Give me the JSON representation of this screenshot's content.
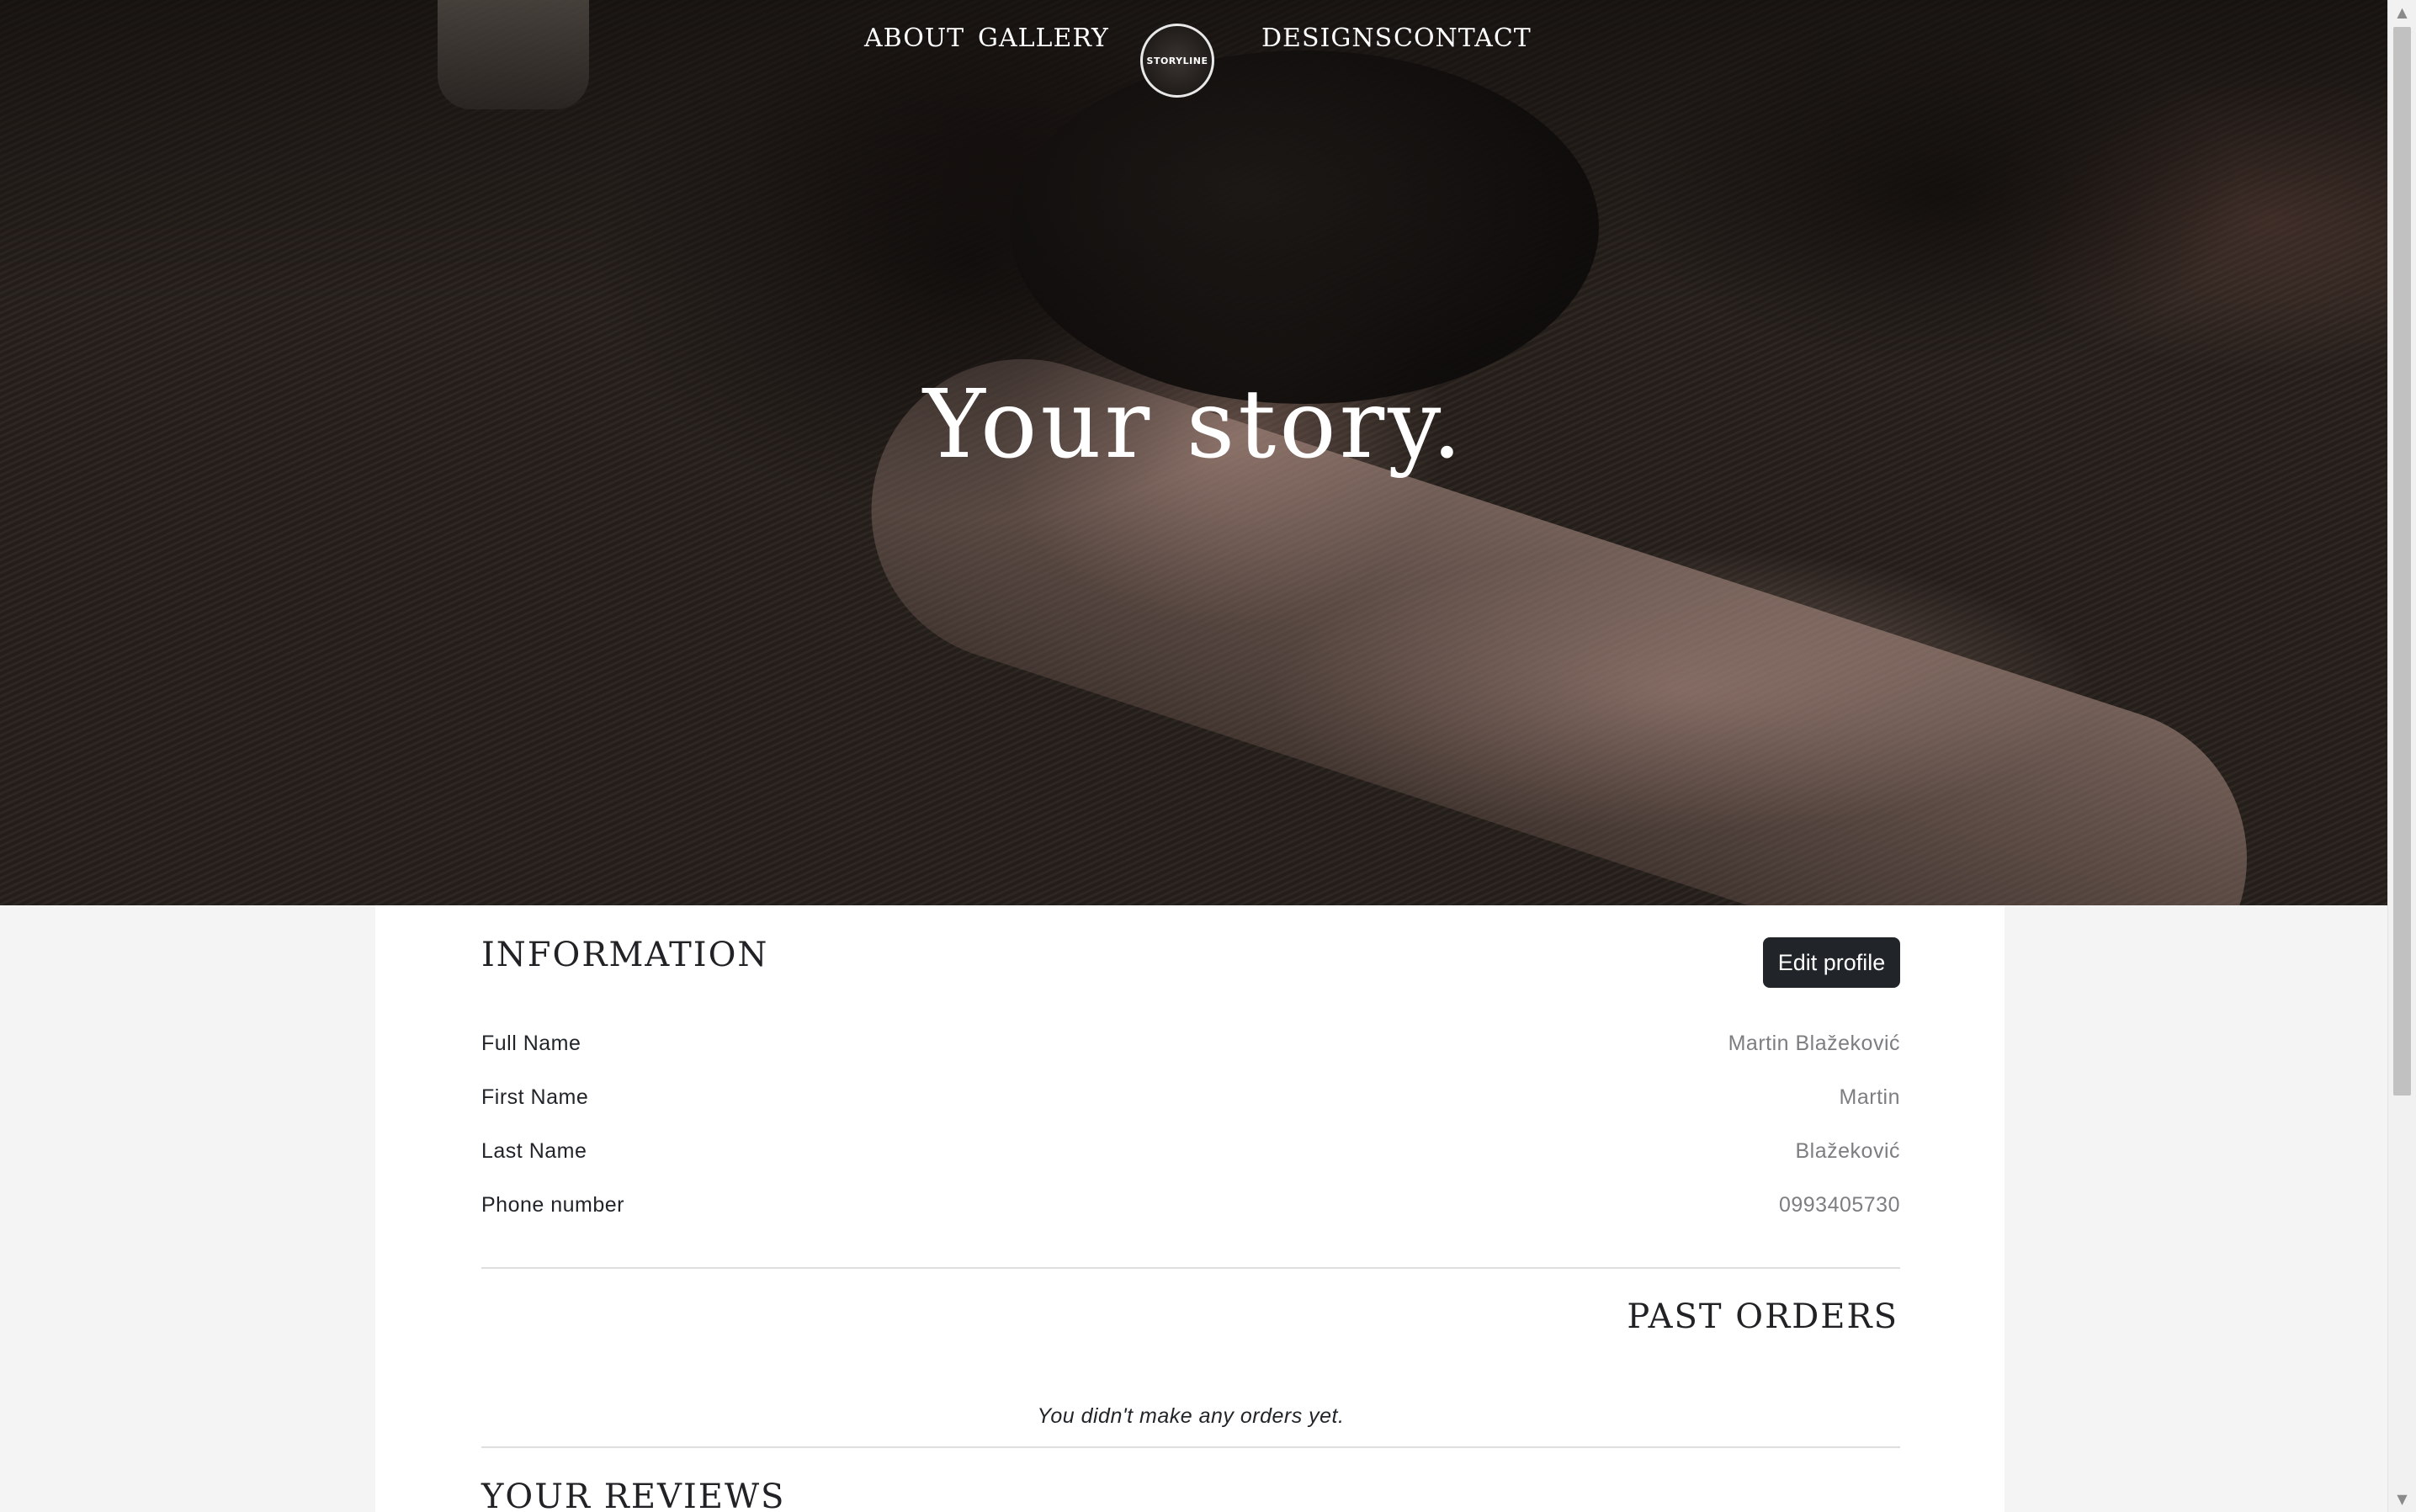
{
  "nav": {
    "about": "ABOUT",
    "gallery": "GALLERY",
    "logo_text": "STORYLINE",
    "designs": "DESIGNS",
    "contact": "CONTACT"
  },
  "hero": {
    "title": "Your story."
  },
  "information": {
    "title": "INFORMATION",
    "edit_button": "Edit profile",
    "rows": [
      {
        "label": "Full Name",
        "value": "Martin Blažeković"
      },
      {
        "label": "First Name",
        "value": "Martin"
      },
      {
        "label": "Last Name",
        "value": "Blažeković"
      },
      {
        "label": "Phone number",
        "value": "0993405730"
      }
    ]
  },
  "past_orders": {
    "title": "PAST ORDERS",
    "empty_message": "You didn't make any orders yet."
  },
  "reviews": {
    "title": "YOUR REVIEWS"
  },
  "scrollbar": {
    "up_icon": "▲",
    "down_icon": "▼"
  },
  "colors": {
    "page_background": "#f4f4f4",
    "card_background": "#ffffff",
    "button_background": "#212529",
    "label_text": "#212529",
    "value_text": "#7d7d82"
  }
}
